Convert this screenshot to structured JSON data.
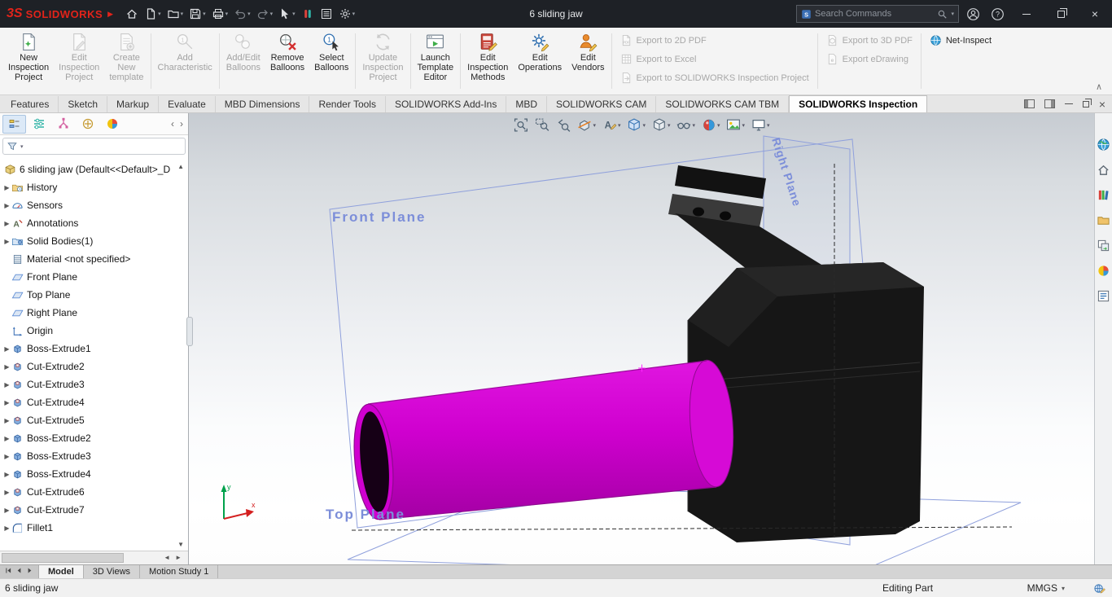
{
  "colors": {
    "brand_red": "#e2231a",
    "accent_blue": "#2f6fb0",
    "selection_magenta": "#cf00cf",
    "plane_label_blue": "#7c8ed9"
  },
  "window": {
    "logo_glyph": "3S",
    "logo_text": "SOLIDWORKS",
    "title": "6 sliding jaw",
    "search_placeholder": "Search Commands"
  },
  "quick_access": {
    "items": [
      {
        "icon": "home",
        "dropdown": false
      },
      {
        "icon": "new-document",
        "dropdown": true
      },
      {
        "icon": "open-folder",
        "dropdown": true
      },
      {
        "icon": "save",
        "dropdown": true
      },
      {
        "icon": "print",
        "dropdown": true
      },
      {
        "icon": "undo",
        "dropdown": true,
        "muted": true
      },
      {
        "icon": "redo",
        "dropdown": true,
        "muted": true
      },
      {
        "icon": "select-cursor",
        "dropdown": true
      },
      {
        "icon": "lifecycle",
        "dropdown": false
      },
      {
        "icon": "task-list",
        "dropdown": false
      },
      {
        "icon": "gear",
        "dropdown": true
      }
    ]
  },
  "ribbon": {
    "collapse_glyph": "∧",
    "groups": [
      {
        "buttons": [
          {
            "label": "New Inspection Project",
            "lines": [
              "New",
              "Inspection",
              "Project"
            ],
            "icon": "new-inspection-project",
            "enabled": true
          },
          {
            "label": "Edit Inspection Project",
            "lines": [
              "Edit",
              "Inspection",
              "Project"
            ],
            "icon": "edit-inspection-project",
            "enabled": false
          },
          {
            "label": "Create New template",
            "lines": [
              "Create",
              "New",
              "template"
            ],
            "icon": "create-new-template",
            "enabled": false
          }
        ]
      },
      {
        "buttons": [
          {
            "label": "Add Characteristic",
            "lines": [
              "Add",
              "Characteristic"
            ],
            "icon": "add-characteristic",
            "enabled": false
          }
        ]
      },
      {
        "buttons": [
          {
            "label": "Add/Edit Balloons",
            "lines": [
              "Add/Edit",
              "Balloons"
            ],
            "icon": "add-edit-balloons",
            "enabled": false
          },
          {
            "label": "Remove Balloons",
            "lines": [
              "Remove",
              "Balloons"
            ],
            "icon": "remove-balloons",
            "enabled": true
          },
          {
            "label": "Select Balloons",
            "lines": [
              "Select",
              "Balloons"
            ],
            "icon": "select-balloons",
            "enabled": true
          }
        ]
      },
      {
        "buttons": [
          {
            "label": "Update Inspection Project",
            "lines": [
              "Update",
              "Inspection",
              "Project"
            ],
            "icon": "update-inspection-project",
            "enabled": false
          }
        ]
      },
      {
        "buttons": [
          {
            "label": "Launch Template Editor",
            "lines": [
              "Launch",
              "Template",
              "Editor"
            ],
            "icon": "launch-template-editor",
            "enabled": true
          }
        ]
      },
      {
        "buttons": [
          {
            "label": "Edit Inspection Methods",
            "lines": [
              "Edit",
              "Inspection",
              "Methods"
            ],
            "icon": "edit-inspection-methods",
            "enabled": true
          },
          {
            "label": "Edit Operations",
            "lines": [
              "Edit",
              "Operations"
            ],
            "icon": "edit-operations",
            "enabled": true
          },
          {
            "label": "Edit Vendors",
            "lines": [
              "Edit",
              "Vendors"
            ],
            "icon": "edit-vendors",
            "enabled": true
          }
        ]
      }
    ],
    "export_columns": [
      {
        "items": [
          {
            "label": "Export to 2D PDF",
            "icon": "export-2d-pdf",
            "enabled": false
          },
          {
            "label": "Export to Excel",
            "icon": "export-excel",
            "enabled": false
          },
          {
            "label": "Export to SOLIDWORKS Inspection Project",
            "icon": "export-swip",
            "enabled": false
          }
        ]
      },
      {
        "items": [
          {
            "label": "Export to 3D PDF",
            "icon": "export-3d-pdf",
            "enabled": false
          },
          {
            "label": "Export eDrawing",
            "icon": "export-edrawing",
            "enabled": false
          }
        ]
      },
      {
        "items": [
          {
            "label": "Net-Inspect",
            "icon": "net-inspect",
            "enabled": true
          }
        ]
      }
    ]
  },
  "command_tabs": {
    "items": [
      {
        "label": "Features"
      },
      {
        "label": "Sketch"
      },
      {
        "label": "Markup"
      },
      {
        "label": "Evaluate"
      },
      {
        "label": "MBD Dimensions"
      },
      {
        "label": "Render Tools"
      },
      {
        "label": "SOLIDWORKS Add-Ins"
      },
      {
        "label": "MBD"
      },
      {
        "label": "SOLIDWORKS CAM"
      },
      {
        "label": "SOLIDWORKS CAM TBM"
      },
      {
        "label": "SOLIDWORKS Inspection",
        "active": true
      }
    ]
  },
  "feature_panel": {
    "tabs": [
      {
        "icon": "fm-featuremanager",
        "active": true
      },
      {
        "icon": "fm-propertymanager",
        "active": false
      },
      {
        "icon": "fm-configurationmanager",
        "active": false
      },
      {
        "icon": "fm-dimxpertmanager",
        "active": false
      },
      {
        "icon": "fm-displaymanager",
        "active": false
      }
    ]
  },
  "feature_tree": {
    "root": "6 sliding jaw (Default<<Default>_D",
    "items": [
      {
        "label": "History",
        "icon": "history",
        "caret": true
      },
      {
        "label": "Sensors",
        "icon": "sensors",
        "caret": true
      },
      {
        "label": "Annotations",
        "icon": "annotations",
        "caret": true
      },
      {
        "label": "Solid Bodies(1)",
        "icon": "solid-bodies",
        "caret": true
      },
      {
        "label": "Material <not specified>",
        "icon": "material",
        "caret": false
      },
      {
        "label": "Front Plane",
        "icon": "plane",
        "caret": false
      },
      {
        "label": "Top Plane",
        "icon": "plane",
        "caret": false
      },
      {
        "label": "Right Plane",
        "icon": "plane",
        "caret": false
      },
      {
        "label": "Origin",
        "icon": "origin",
        "caret": false
      },
      {
        "label": "Boss-Extrude1",
        "icon": "boss-extrude",
        "caret": true
      },
      {
        "label": "Cut-Extrude2",
        "icon": "cut-extrude",
        "caret": true
      },
      {
        "label": "Cut-Extrude3",
        "icon": "cut-extrude",
        "caret": true
      },
      {
        "label": "Cut-Extrude4",
        "icon": "cut-extrude",
        "caret": true
      },
      {
        "label": "Cut-Extrude5",
        "icon": "cut-extrude",
        "caret": true
      },
      {
        "label": "Boss-Extrude2",
        "icon": "boss-extrude",
        "caret": true
      },
      {
        "label": "Boss-Extrude3",
        "icon": "boss-extrude",
        "caret": true
      },
      {
        "label": "Boss-Extrude4",
        "icon": "boss-extrude",
        "caret": true
      },
      {
        "label": "Cut-Extrude6",
        "icon": "cut-extrude",
        "caret": true
      },
      {
        "label": "Cut-Extrude7",
        "icon": "cut-extrude",
        "caret": true
      },
      {
        "label": "Fillet1",
        "icon": "fillet",
        "caret": true
      }
    ]
  },
  "heads_up": {
    "items": [
      {
        "icon": "zoom-fit",
        "dropdown": false
      },
      {
        "icon": "zoom-area",
        "dropdown": false
      },
      {
        "icon": "previous-view",
        "dropdown": false
      },
      {
        "icon": "section-view",
        "dropdown": true
      },
      {
        "icon": "dynamic-annotation",
        "dropdown": true
      },
      {
        "icon": "view-orientation",
        "dropdown": true
      },
      {
        "icon": "display-style",
        "dropdown": true
      },
      {
        "icon": "hide-show",
        "dropdown": true
      },
      {
        "icon": "edit-appearance",
        "dropdown": true
      },
      {
        "icon": "apply-scene",
        "dropdown": true
      },
      {
        "icon": "view-settings",
        "dropdown": true
      }
    ]
  },
  "task_pane": {
    "items": [
      "marketplace-globe",
      "resources-home",
      "design-library",
      "file-explorer",
      "view-palette",
      "appearances-ball",
      "custom-properties"
    ]
  },
  "viewport": {
    "plane_labels": {
      "front": "Front Plane",
      "top": "Top Plane",
      "right": "Right Plane"
    },
    "axis_labels": {
      "x": "x",
      "y": "y"
    }
  },
  "document_tabs": {
    "nav_icons": [
      "tab-first",
      "tab-prev",
      "tab-next"
    ],
    "items": [
      {
        "label": "Model",
        "active": true
      },
      {
        "label": "3D Views",
        "active": false
      },
      {
        "label": "Motion Study 1",
        "active": false
      }
    ]
  },
  "status_bar": {
    "document": "6 sliding jaw",
    "mode": "Editing Part",
    "units": "MMGS"
  }
}
